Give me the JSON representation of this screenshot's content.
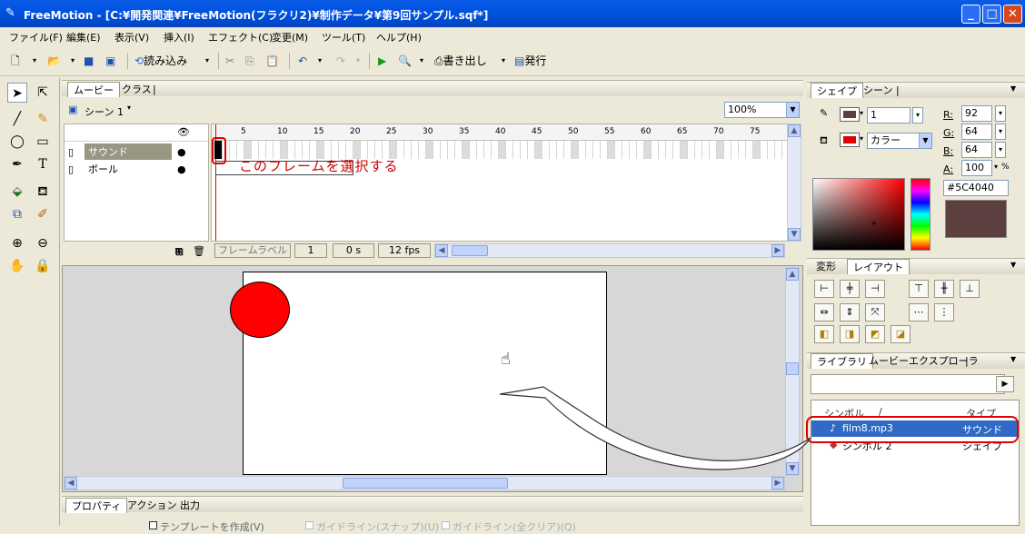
{
  "window": {
    "title": "FreeMotion - [C:¥開発関連¥FreeMotion(フラクリ2)¥制作データ¥第9回サンプル.sqf*]"
  },
  "menu": [
    "ファイル(F)",
    "編集(E)",
    "表示(V)",
    "挿入(I)",
    "エフェクト(C)",
    "変更(M)",
    "ツール(T)",
    "ヘルプ(H)"
  ],
  "toolbar": {
    "load": "読み込み",
    "export": "書き出し",
    "publish": "発行"
  },
  "timeline": {
    "tabs": [
      "ムービー",
      "クラス"
    ],
    "scene": "シーン 1",
    "zoom": "100%",
    "ruler": [
      "5",
      "10",
      "15",
      "20",
      "25",
      "30",
      "35",
      "40",
      "45",
      "50",
      "55",
      "60",
      "65",
      "70",
      "75"
    ],
    "layers": [
      {
        "name": "サウンド",
        "selected": true
      },
      {
        "name": "ボール",
        "selected": false
      }
    ],
    "annotation": "このフレームを選択する",
    "status": {
      "frame_label": "フレームラベル",
      "frame": "1",
      "time": "0 s",
      "fps": "12 fps"
    }
  },
  "shape_panel": {
    "tabs": [
      "シェイプ",
      "シーン"
    ],
    "line_width": "1",
    "fill_type": "カラー",
    "r": "92",
    "g": "64",
    "b": "64",
    "a": "100",
    "r_label": "R:",
    "g_label": "G:",
    "b_label": "B:",
    "a_label": "A:",
    "percent": "%",
    "hex": "#5C4040",
    "line_color": "#5c4040",
    "fill_color": "#e00000"
  },
  "layout_panel": {
    "tabs": [
      "変形",
      "レイアウト"
    ]
  },
  "library_panel": {
    "tabs": [
      "ライブラリ",
      "ムービーエクスプローラ"
    ],
    "columns": [
      "シンボル",
      "タイプ"
    ],
    "items": [
      {
        "name": "film8.mp3",
        "type": "サウンド",
        "selected": true
      },
      {
        "name": "シンボル 2",
        "type": "シェイプ",
        "selected": false
      }
    ]
  },
  "bottom_tabs": [
    "プロパティ",
    "アクション",
    "出力"
  ],
  "bottom_partial": [
    "テンプレートを作成(V)",
    "ガイドライン(スナップ)(U)",
    "ガイドライン(全クリア)(Q)"
  ]
}
